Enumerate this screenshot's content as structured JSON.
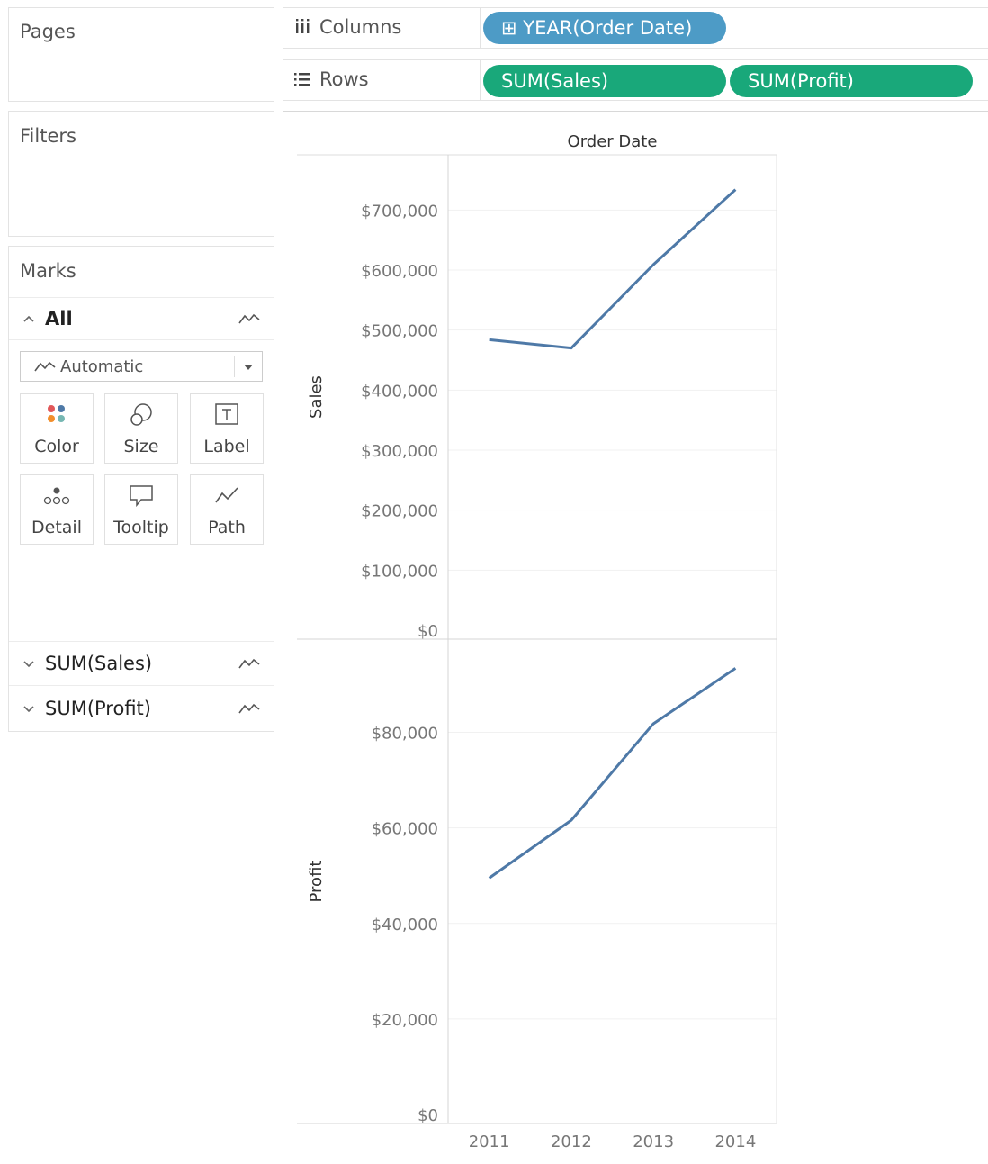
{
  "pages": {
    "title": "Pages"
  },
  "filters": {
    "title": "Filters"
  },
  "columns": {
    "label": "Columns",
    "pill": "⊞ YEAR(Order Date)",
    "icon": "columns-icon"
  },
  "rows": {
    "label": "Rows",
    "pills": [
      "SUM(Sales)",
      "SUM(Profit)"
    ],
    "icon": "rows-icon"
  },
  "marks": {
    "title": "Marks",
    "all_label": "All",
    "mark_type": "Automatic",
    "tiles": [
      {
        "label": "Color",
        "icon": "color-icon"
      },
      {
        "label": "Size",
        "icon": "size-icon"
      },
      {
        "label": "Label",
        "icon": "label-icon"
      },
      {
        "label": "Detail",
        "icon": "detail-icon"
      },
      {
        "label": "Tooltip",
        "icon": "tooltip-icon"
      },
      {
        "label": "Path",
        "icon": "path-icon"
      }
    ],
    "measures": [
      "SUM(Sales)",
      "SUM(Profit)"
    ]
  },
  "colors": {
    "line": "#4e79a7",
    "pill_dimension": "#4d9bc6",
    "pill_measure": "#19a87a"
  },
  "chart_data": [
    {
      "type": "line",
      "title": "Order Date",
      "xlabel": "",
      "ylabel": "Sales",
      "x": [
        "2011",
        "2012",
        "2013",
        "2014"
      ],
      "values": [
        484000,
        470000,
        609000,
        734000
      ],
      "ylim": [
        0,
        780000
      ],
      "yticks": [
        0,
        100000,
        200000,
        300000,
        400000,
        500000,
        600000,
        700000
      ],
      "ytick_labels": [
        "$0",
        "$100,000",
        "$200,000",
        "$300,000",
        "$400,000",
        "$500,000",
        "$600,000",
        "$700,000"
      ],
      "grid": true
    },
    {
      "type": "line",
      "xlabel": "",
      "ylabel": "Profit",
      "x": [
        "2011",
        "2012",
        "2013",
        "2014"
      ],
      "values": [
        49500,
        61600,
        81800,
        93400
      ],
      "ylim": [
        0,
        98000
      ],
      "yticks": [
        0,
        20000,
        40000,
        60000,
        80000
      ],
      "ytick_labels": [
        "$0",
        "$20,000",
        "$40,000",
        "$60,000",
        "$80,000"
      ],
      "grid": true
    }
  ]
}
